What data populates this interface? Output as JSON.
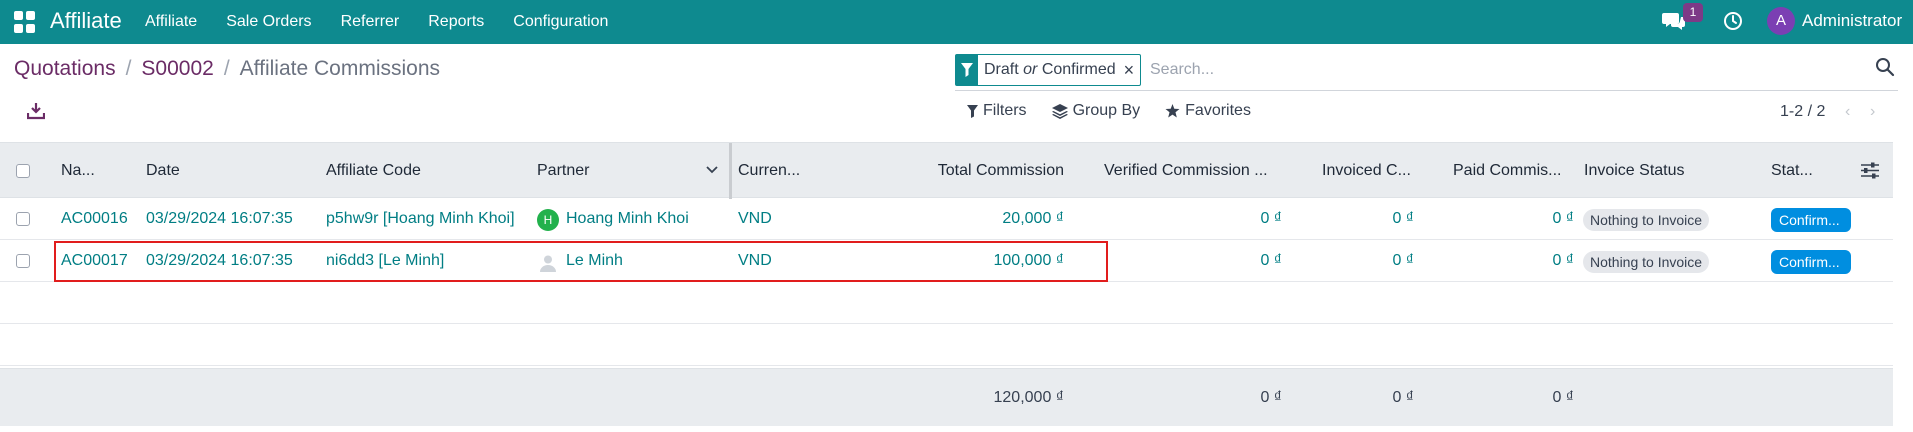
{
  "navbar": {
    "app_name": "Affiliate",
    "menu": [
      "Affiliate",
      "Sale Orders",
      "Referrer",
      "Reports",
      "Configuration"
    ],
    "chat_badge": "1",
    "user_initial": "A",
    "user_name": "Administrator",
    "bg_color": "#0e8a8f"
  },
  "breadcrumb": {
    "items": [
      "Quotations",
      "S00002"
    ],
    "separator": "/",
    "current": "Affiliate Commissions"
  },
  "search": {
    "facet_part1": "Draft",
    "facet_or": "or",
    "facet_part2": "Confirmed",
    "facet_close": "×",
    "placeholder": "Search..."
  },
  "toolbar": {
    "filters": "Filters",
    "group_by": "Group By",
    "favorites": "Favorites",
    "pager": "1-2 / 2",
    "pager_prev": "‹",
    "pager_next": "›"
  },
  "table": {
    "headers": [
      "Na...",
      "Date",
      "Affiliate Code",
      "Partner",
      "Curren...",
      "Total Commission",
      "Verified Commission ...",
      "Invoiced C...",
      "Paid Commis...",
      "Invoice Status",
      "Stat..."
    ],
    "rows": [
      {
        "name": "AC00016",
        "date": "03/29/2024 16:07:35",
        "affiliate_code": "p5hw9r [Hoang Minh Khoi]",
        "partner_initial": "H",
        "partner": "Hoang Minh Khoi",
        "currency": "VND",
        "total_commission": "20,000 ₫",
        "verified_commission": "0 ₫",
        "invoiced_commission": "0 ₫",
        "paid_commission": "0 ₫",
        "invoice_status": "Nothing to Invoice",
        "status": "Confirm..."
      },
      {
        "name": "AC00017",
        "date": "03/29/2024 16:07:35",
        "affiliate_code": "ni6dd3 [Le Minh]",
        "partner_initial": "",
        "partner": "Le Minh",
        "currency": "VND",
        "total_commission": "100,000 ₫",
        "verified_commission": "0 ₫",
        "invoiced_commission": "0 ₫",
        "paid_commission": "0 ₫",
        "invoice_status": "Nothing to Invoice",
        "status": "Confirm..."
      }
    ],
    "totals": {
      "total_commission": "120,000 ₫",
      "verified_commission": "0 ₫",
      "invoiced_commission": "0 ₫",
      "paid_commission": "0 ₫"
    }
  },
  "colors": {
    "link": "#017e84",
    "status_badge": "#008ee0",
    "highlight": "#e11d1d",
    "breadcrumb_link": "#6b2c66"
  }
}
